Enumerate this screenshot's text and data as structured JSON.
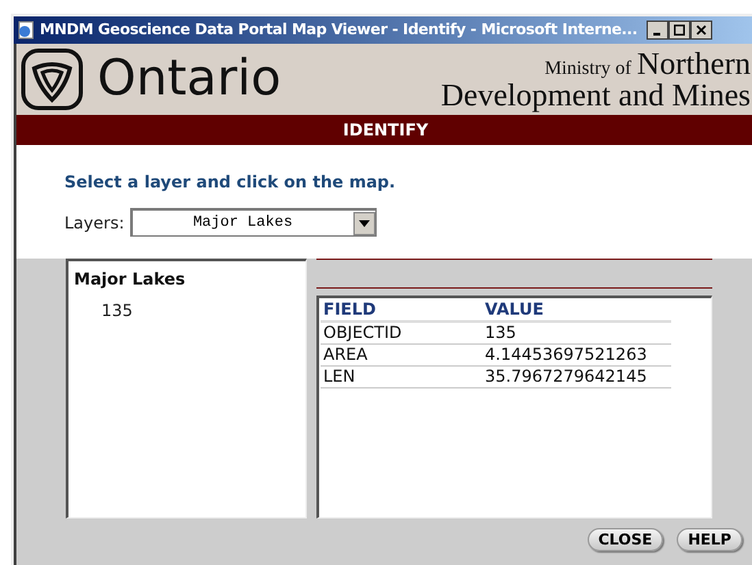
{
  "window": {
    "title": "MNDM Geoscience Data Portal Map Viewer - Identify - Microsoft Interne..."
  },
  "header": {
    "logo_text": "Ontario",
    "ministry_small": "Ministry of",
    "ministry_large": "Northern",
    "ministry_line2": "Development and Mines"
  },
  "banner": "IDENTIFY",
  "instruction": "Select a layer and click on the map.",
  "layers": {
    "label": "Layers:",
    "value": "Major Lakes"
  },
  "results": {
    "layer": "Major Lakes",
    "features": [
      {
        "id": "135",
        "selected": false
      }
    ]
  },
  "table": {
    "columns": [
      "FIELD",
      "VALUE"
    ],
    "rows": [
      [
        "OBJECTID",
        "135"
      ],
      [
        "AREA",
        "4.14453697521263"
      ],
      [
        "LEN",
        "35.7967279642145"
      ]
    ]
  },
  "buttons": [
    "CLOSE",
    "HELP"
  ]
}
